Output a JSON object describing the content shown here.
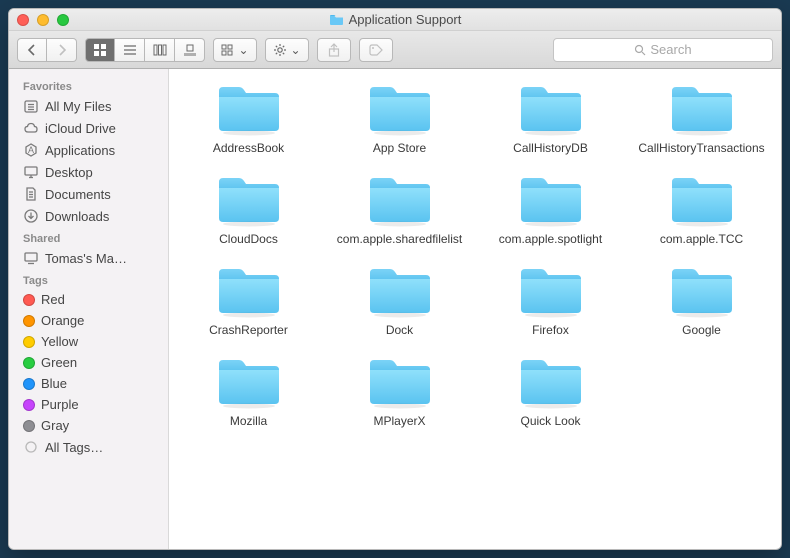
{
  "window": {
    "title": "Application Support"
  },
  "search": {
    "placeholder": "Search"
  },
  "sidebar": {
    "sections": [
      {
        "header": "Favorites",
        "items": [
          {
            "label": "All My Files",
            "icon": "all-files"
          },
          {
            "label": "iCloud Drive",
            "icon": "cloud"
          },
          {
            "label": "Applications",
            "icon": "apps"
          },
          {
            "label": "Desktop",
            "icon": "desktop"
          },
          {
            "label": "Documents",
            "icon": "documents"
          },
          {
            "label": "Downloads",
            "icon": "downloads"
          }
        ]
      },
      {
        "header": "Shared",
        "items": [
          {
            "label": "Tomas's Ma…",
            "icon": "computer"
          }
        ]
      },
      {
        "header": "Tags",
        "items": [
          {
            "label": "Red",
            "icon": "tag",
            "color": "#ff5a52"
          },
          {
            "label": "Orange",
            "icon": "tag",
            "color": "#ff9500"
          },
          {
            "label": "Yellow",
            "icon": "tag",
            "color": "#ffcc00"
          },
          {
            "label": "Green",
            "icon": "tag",
            "color": "#28cd41"
          },
          {
            "label": "Blue",
            "icon": "tag",
            "color": "#2094fa"
          },
          {
            "label": "Purple",
            "icon": "tag",
            "color": "#c644fc"
          },
          {
            "label": "Gray",
            "icon": "tag",
            "color": "#8e8e93"
          },
          {
            "label": "All Tags…",
            "icon": "alltags"
          }
        ]
      }
    ]
  },
  "folders": [
    "AddressBook",
    "App Store",
    "CallHistoryDB",
    "CallHistoryTransactions",
    "CloudDocs",
    "com.apple.sharedfilelist",
    "com.apple.spotlight",
    "com.apple.TCC",
    "CrashReporter",
    "Dock",
    "Firefox",
    "Google",
    "Mozilla",
    "MPlayerX",
    "Quick Look"
  ]
}
